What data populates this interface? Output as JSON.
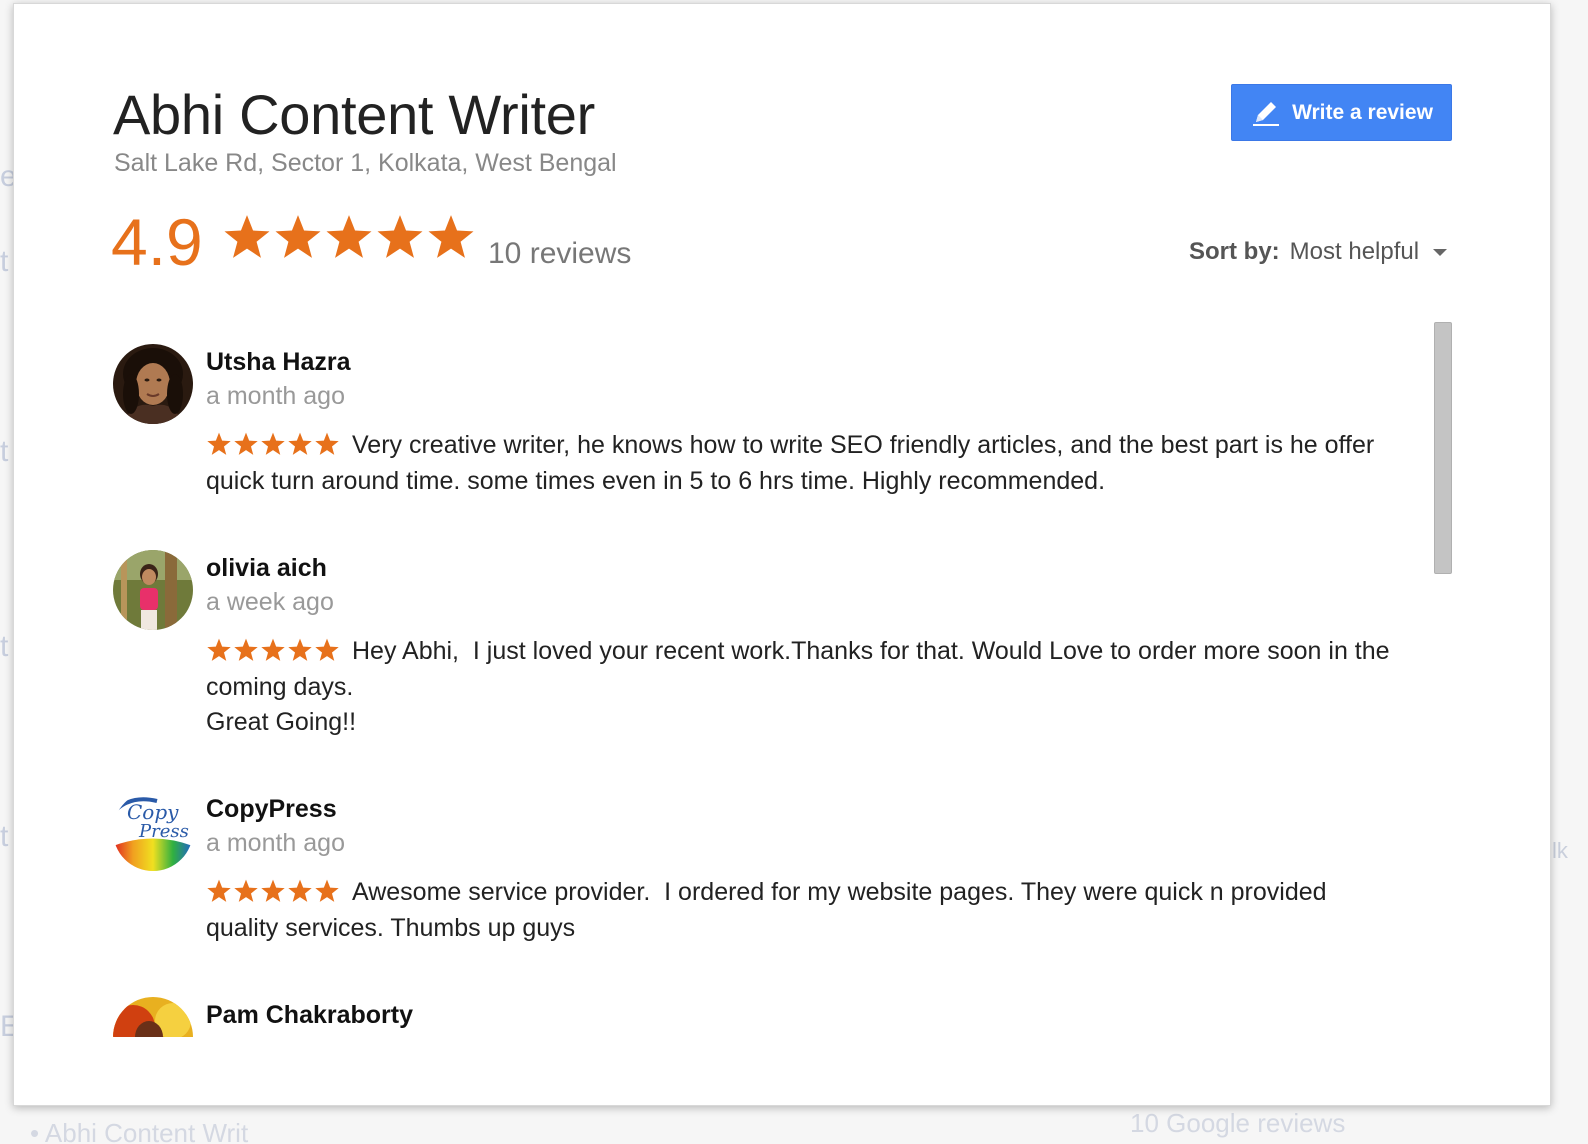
{
  "business": {
    "name": "Abhi Content Writer",
    "address": "Salt Lake Rd, Sector 1, Kolkata, West Bengal"
  },
  "write_review": {
    "label": "Write a review",
    "icon": "pencil-icon"
  },
  "summary": {
    "rating": "4.9",
    "stars": 5,
    "star_color": "#e7711b",
    "reviews_label": "10 reviews"
  },
  "sort": {
    "label": "Sort by:",
    "value": "Most helpful"
  },
  "reviews": [
    {
      "name": "Utsha Hazra",
      "time": "a month ago",
      "stars": 5,
      "text": "Very creative writer, he knows how to write SEO friendly articles, and the best part is he offer quick turn around time. some times even in 5 to 6 hrs time. Highly recommended."
    },
    {
      "name": "olivia aich",
      "time": "a week ago",
      "stars": 5,
      "text": "Hey Abhi,  I just loved your recent work.Thanks for that. Would Love to order more soon in the coming days.",
      "text2": "Great Going!!"
    },
    {
      "name": "CopyPress",
      "time": "a month ago",
      "stars": 5,
      "text": "Awesome service provider.  I ordered for my website pages. They were quick n provided quality services. Thumbs up guys",
      "avatar_logo": "Copy Press"
    },
    {
      "name": "Pam Chakraborty"
    }
  ],
  "background": {
    "bottom_left": "• Abhi Content Writ",
    "bottom_right": "10 Google reviews"
  }
}
